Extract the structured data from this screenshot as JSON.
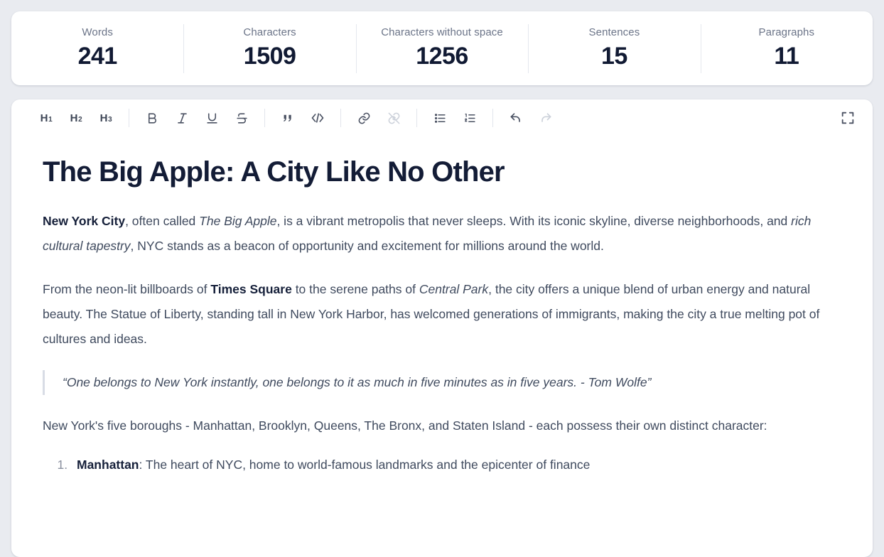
{
  "stats": [
    {
      "label": "Words",
      "value": "241"
    },
    {
      "label": "Characters",
      "value": "1509"
    },
    {
      "label": "Characters without space",
      "value": "1256"
    },
    {
      "label": "Sentences",
      "value": "15"
    },
    {
      "label": "Paragraphs",
      "value": "11"
    }
  ],
  "toolbar": {
    "h1": "H",
    "h1_sub": "1",
    "h2": "H",
    "h2_sub": "2",
    "h3": "H",
    "h3_sub": "3",
    "bold": "B",
    "italic": "I",
    "underline": "U",
    "strike": "S",
    "quote_icon": "blockquote-icon",
    "code_icon": "code-icon",
    "link_icon": "link-icon",
    "unlink_icon": "unlink-icon",
    "bullet_list_icon": "bullet-list-icon",
    "numbered_list_icon": "numbered-list-icon",
    "undo_icon": "undo-icon",
    "redo_icon": "redo-icon",
    "fullscreen_icon": "fullscreen-icon"
  },
  "document": {
    "title": "The Big Apple: A City Like No Other",
    "p1": {
      "bold1": "New York City",
      "t1": ", often called ",
      "italic1": "The Big Apple",
      "t2": ", is a vibrant metropolis that never sleeps. With its iconic skyline, diverse neighborhoods, and ",
      "italic2": "rich cultural tapestry",
      "t3": ", NYC stands as a beacon of opportunity and excitement for millions around the world."
    },
    "p2": {
      "t1": "From the neon-lit billboards of ",
      "bold1": "Times Square",
      "t2": " to the serene paths of ",
      "italic1": "Central Park",
      "t3": ", the city offers a unique blend of urban energy and natural beauty. The Statue of Liberty, standing tall in New York Harbor, has welcomed generations of immigrants, making the city a true melting pot of cultures and ideas."
    },
    "quote": "“One belongs to New York instantly, one belongs to it as much in five minutes as in five years. - Tom Wolfe”",
    "p3": "New York's five boroughs - Manhattan, Brooklyn, Queens, The Bronx, and Staten Island - each possess their own distinct character:",
    "list": [
      {
        "bold": "Manhattan",
        "rest": ": The heart of NYC, home to world-famous landmarks and the epicenter of finance"
      }
    ]
  }
}
